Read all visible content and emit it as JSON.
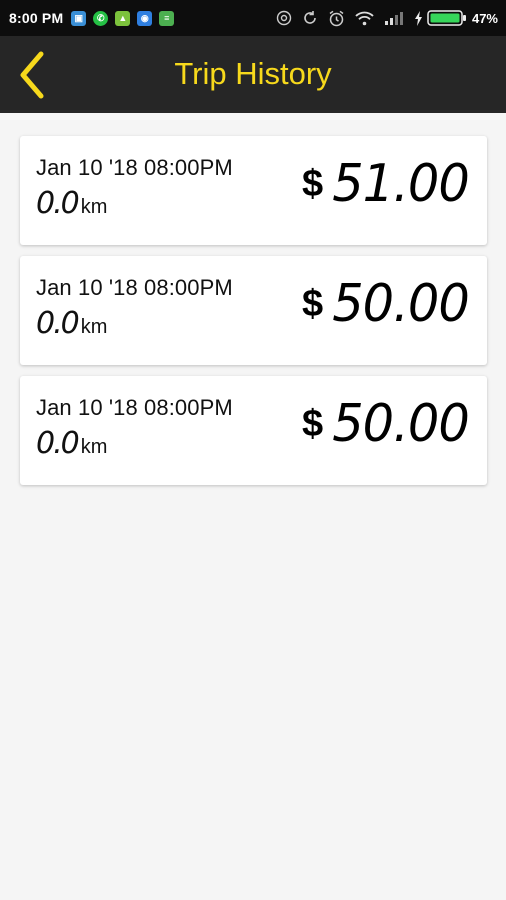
{
  "status_bar": {
    "time": "8:00 PM",
    "battery_percent": "47%",
    "notification_icons": [
      "gallery-icon",
      "whatsapp-icon",
      "android-icon",
      "app-icon",
      "notes-icon"
    ],
    "system_icons": [
      "hotspot-icon",
      "sync-icon",
      "alarm-icon",
      "wifi-icon",
      "signal-icon",
      "charging-icon",
      "battery-icon"
    ]
  },
  "header": {
    "title": "Trip History",
    "accent_color": "#f7d91c",
    "background_color": "#262626"
  },
  "trips": [
    {
      "date": "Jan 10 '18 08:00PM",
      "distance": "0.0",
      "distance_unit": "km",
      "currency": "$",
      "fare": "51.00"
    },
    {
      "date": "Jan 10 '18 08:00PM",
      "distance": "0.0",
      "distance_unit": "km",
      "currency": "$",
      "fare": "50.00"
    },
    {
      "date": "Jan 10 '18 08:00PM",
      "distance": "0.0",
      "distance_unit": "km",
      "currency": "$",
      "fare": "50.00"
    }
  ]
}
